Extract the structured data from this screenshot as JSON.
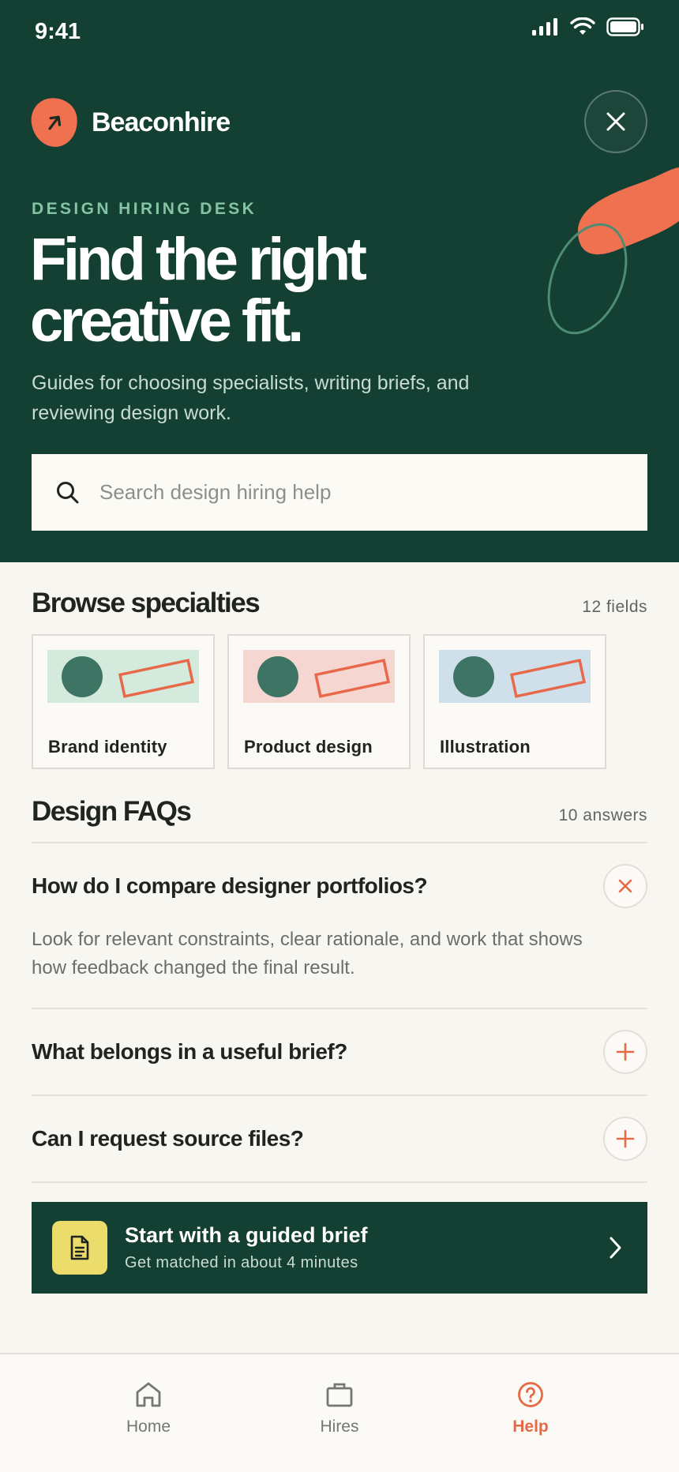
{
  "status_bar": {
    "time": "9:41"
  },
  "brand": {
    "name": "Beaconhire"
  },
  "hero": {
    "eyebrow": "DESIGN HIRING DESK",
    "headline_line1": "Find the right",
    "headline_line2": "creative fit.",
    "subhead": "Guides for choosing specialists, writing briefs, and reviewing design work."
  },
  "search": {
    "placeholder": "Search design hiring help"
  },
  "specialties": {
    "title": "Browse specialties",
    "count": "12 fields",
    "items": [
      {
        "label": "Brand identity",
        "color": "#d4eadd"
      },
      {
        "label": "Product design",
        "color": "#f6d6d1"
      },
      {
        "label": "Illustration",
        "color": "#cfe0ea"
      }
    ]
  },
  "faqs": {
    "title": "Design FAQs",
    "count": "10 answers",
    "items": [
      {
        "question": "How do I compare designer portfolios?",
        "answer": "Look for relevant constraints, clear rationale, and work that shows how feedback changed the final result.",
        "expanded": true
      },
      {
        "question": "What belongs in a useful brief?",
        "expanded": false
      },
      {
        "question": "Can I request source files?",
        "expanded": false
      }
    ]
  },
  "cta": {
    "title": "Start with a guided brief",
    "subtitle": "Get matched in about 4 minutes"
  },
  "tabs": [
    {
      "label": "Home",
      "icon": "home-icon",
      "active": false
    },
    {
      "label": "Hires",
      "icon": "briefcase-icon",
      "active": false
    },
    {
      "label": "Help",
      "icon": "help-icon",
      "active": true
    }
  ],
  "colors": {
    "primary": "#143f33",
    "accent": "#ef714f",
    "cta_icon_bg": "#ecdc6c",
    "eyebrow": "#82c4a4"
  }
}
